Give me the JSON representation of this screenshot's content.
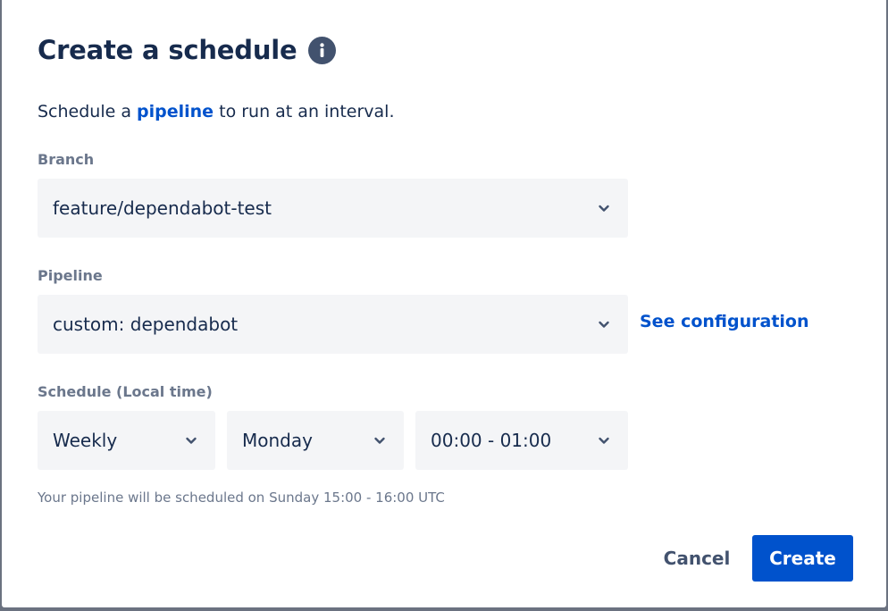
{
  "dialog": {
    "title": "Create a schedule",
    "description": {
      "prefix": "Schedule a ",
      "link": "pipeline",
      "suffix": " to run at an interval."
    }
  },
  "branch": {
    "label": "Branch",
    "value": "feature/dependabot-test"
  },
  "pipeline": {
    "label": "Pipeline",
    "value": "custom: dependabot",
    "config_link": "See configuration"
  },
  "schedule": {
    "label": "Schedule (Local time)",
    "frequency": "Weekly",
    "day": "Monday",
    "time": "00:00 - 01:00",
    "hint": "Your pipeline will be scheduled on Sunday 15:00 - 16:00 UTC"
  },
  "footer": {
    "cancel_label": "Cancel",
    "create_label": "Create"
  },
  "colors": {
    "primary": "#0052cc",
    "text": "#172b4d",
    "subtle_text": "#6b778c",
    "field_bg": "#f4f5f7"
  },
  "icons": {
    "info": "info-icon",
    "chevron": "chevron-down-icon"
  }
}
